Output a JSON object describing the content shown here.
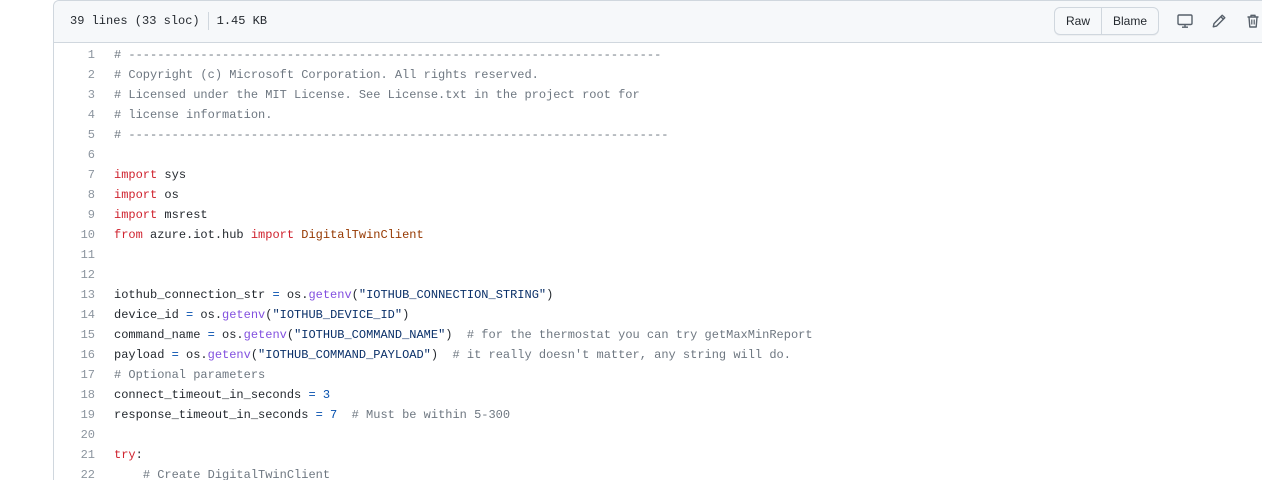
{
  "header": {
    "lines": "39 lines (33 sloc)",
    "size": "1.45 KB",
    "raw_label": "Raw",
    "blame_label": "Blame"
  },
  "code_lines": [
    {
      "n": "1",
      "parts": [
        [
          "c",
          "# --------------------------------------------------------------------------"
        ]
      ]
    },
    {
      "n": "2",
      "parts": [
        [
          "c",
          "# Copyright (c) Microsoft Corporation. All rights reserved."
        ]
      ]
    },
    {
      "n": "3",
      "parts": [
        [
          "c",
          "# Licensed under the MIT License. See License.txt in the project root for"
        ]
      ]
    },
    {
      "n": "4",
      "parts": [
        [
          "c",
          "# license information."
        ]
      ]
    },
    {
      "n": "5",
      "parts": [
        [
          "c",
          "# ---------------------------------------------------------------------------"
        ]
      ]
    },
    {
      "n": "6",
      "parts": []
    },
    {
      "n": "7",
      "parts": [
        [
          "k",
          "import"
        ],
        [
          "",
          " sys"
        ]
      ]
    },
    {
      "n": "8",
      "parts": [
        [
          "k",
          "import"
        ],
        [
          "",
          " os"
        ]
      ]
    },
    {
      "n": "9",
      "parts": [
        [
          "k",
          "import"
        ],
        [
          "",
          " msrest"
        ]
      ]
    },
    {
      "n": "10",
      "parts": [
        [
          "k",
          "from"
        ],
        [
          "",
          " azure.iot.hub "
        ],
        [
          "k",
          "import"
        ],
        [
          "",
          " "
        ],
        [
          "cls",
          "DigitalTwinClient"
        ]
      ]
    },
    {
      "n": "11",
      "parts": []
    },
    {
      "n": "12",
      "parts": []
    },
    {
      "n": "13",
      "parts": [
        [
          "",
          "iothub_connection_str "
        ],
        [
          "o",
          "="
        ],
        [
          "",
          " os."
        ],
        [
          "f",
          "getenv"
        ],
        [
          "",
          "("
        ],
        [
          "s",
          "\"IOTHUB_CONNECTION_STRING\""
        ],
        [
          "",
          ")"
        ]
      ]
    },
    {
      "n": "14",
      "parts": [
        [
          "",
          "device_id "
        ],
        [
          "o",
          "="
        ],
        [
          "",
          " os."
        ],
        [
          "f",
          "getenv"
        ],
        [
          "",
          "("
        ],
        [
          "s",
          "\"IOTHUB_DEVICE_ID\""
        ],
        [
          "",
          ")"
        ]
      ]
    },
    {
      "n": "15",
      "parts": [
        [
          "",
          "command_name "
        ],
        [
          "o",
          "="
        ],
        [
          "",
          " os."
        ],
        [
          "f",
          "getenv"
        ],
        [
          "",
          "("
        ],
        [
          "s",
          "\"IOTHUB_COMMAND_NAME\""
        ],
        [
          "",
          ")  "
        ],
        [
          "c",
          "# for the thermostat you can try getMaxMinReport"
        ]
      ]
    },
    {
      "n": "16",
      "parts": [
        [
          "",
          "payload "
        ],
        [
          "o",
          "="
        ],
        [
          "",
          " os."
        ],
        [
          "f",
          "getenv"
        ],
        [
          "",
          "("
        ],
        [
          "s",
          "\"IOTHUB_COMMAND_PAYLOAD\""
        ],
        [
          "",
          ")  "
        ],
        [
          "c",
          "# it really doesn't matter, any string will do."
        ]
      ]
    },
    {
      "n": "17",
      "parts": [
        [
          "c",
          "# Optional parameters"
        ]
      ]
    },
    {
      "n": "18",
      "parts": [
        [
          "",
          "connect_timeout_in_seconds "
        ],
        [
          "o",
          "="
        ],
        [
          "",
          " "
        ],
        [
          "n",
          "3"
        ]
      ]
    },
    {
      "n": "19",
      "parts": [
        [
          "",
          "response_timeout_in_seconds "
        ],
        [
          "o",
          "="
        ],
        [
          "",
          " "
        ],
        [
          "n",
          "7"
        ],
        [
          "",
          "  "
        ],
        [
          "c",
          "# Must be within 5-300"
        ]
      ]
    },
    {
      "n": "20",
      "parts": []
    },
    {
      "n": "21",
      "parts": [
        [
          "k",
          "try"
        ],
        [
          "",
          ":"
        ]
      ]
    },
    {
      "n": "22",
      "parts": [
        [
          "",
          "    "
        ],
        [
          "c",
          "# Create DigitalTwinClient"
        ]
      ]
    }
  ]
}
